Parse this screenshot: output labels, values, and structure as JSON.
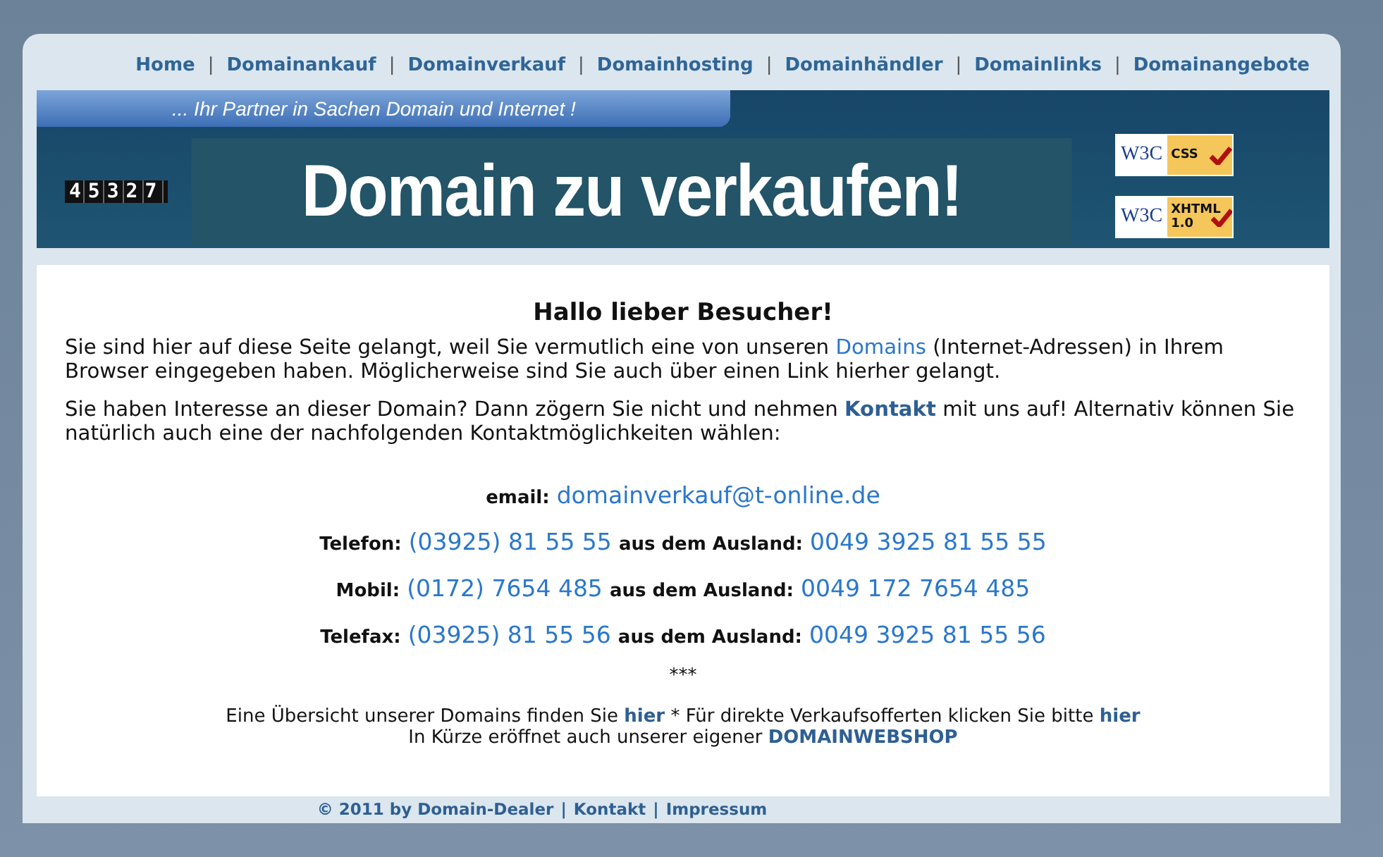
{
  "nav": {
    "separator": "|",
    "items": [
      "Home",
      "Domainankauf",
      "Domainverkauf",
      "Domainhosting",
      "Domainhändler",
      "Domainlinks",
      "Domainangebote"
    ]
  },
  "banner": {
    "slogan": "... Ihr Partner in Sachen Domain und Internet !",
    "counter": "45327",
    "headline": "Domain zu verkaufen!",
    "badges": [
      {
        "logo": "W3C",
        "label": "CSS"
      },
      {
        "logo": "W3C",
        "label": "XHTML 1.0"
      }
    ]
  },
  "content": {
    "heading": "Hallo lieber Besucher!",
    "paragraphs": [
      [
        {
          "text": "Sie sind hier auf diese Seite gelangt, weil Sie vermutlich eine von unseren ",
          "kind": "plain"
        },
        {
          "text": "Domains",
          "kind": "link"
        },
        {
          "text": " (Internet-Adressen) in Ihrem Browser eingegeben haben. Möglicherweise sind Sie auch über einen Link hierher gelangt.",
          "kind": "plain"
        }
      ],
      [
        {
          "text": "Sie haben Interesse an dieser Domain? Dann zögern Sie nicht und nehmen ",
          "kind": "plain"
        },
        {
          "text": "Kontakt",
          "kind": "boldlink"
        },
        {
          "text": " mit uns auf! Alternativ können Sie natürlich auch eine der nachfolgenden Kontaktmöglichkeiten wählen:",
          "kind": "plain"
        }
      ]
    ],
    "contacts": [
      {
        "label": "email:",
        "value": "domainverkauf@t-online.de"
      },
      {
        "label": "Telefon:",
        "value": "(03925) 81 55 55",
        "abroad_label": "aus dem Ausland:",
        "abroad_value": "0049 3925 81 55 55"
      },
      {
        "label": "Mobil:",
        "value": "(0172) 7654 485",
        "abroad_label": "aus dem Ausland:",
        "abroad_value": "0049 172 7654 485"
      },
      {
        "label": "Telefax:",
        "value": "(03925) 81 55 56",
        "abroad_label": "aus dem Ausland:",
        "abroad_value": "0049 3925 81 55 56"
      }
    ],
    "divider": "***",
    "notes": [
      [
        {
          "text": "Eine Übersicht unserer Domains finden Sie ",
          "kind": "plain"
        },
        {
          "text": "hier",
          "kind": "boldlink"
        },
        {
          "text": " * Für direkte Verkaufsofferten klicken Sie bitte ",
          "kind": "plain"
        },
        {
          "text": "hier",
          "kind": "boldlink"
        }
      ],
      [
        {
          "text": "In Kürze eröffnet auch unserer eigener ",
          "kind": "plain"
        },
        {
          "text": "DOMAINWEBSHOP",
          "kind": "boldlink"
        }
      ]
    ]
  },
  "footer": {
    "separator": "|",
    "items": [
      "© 2011 by Domain-Dealer",
      "Kontakt",
      "Impressum"
    ]
  }
}
